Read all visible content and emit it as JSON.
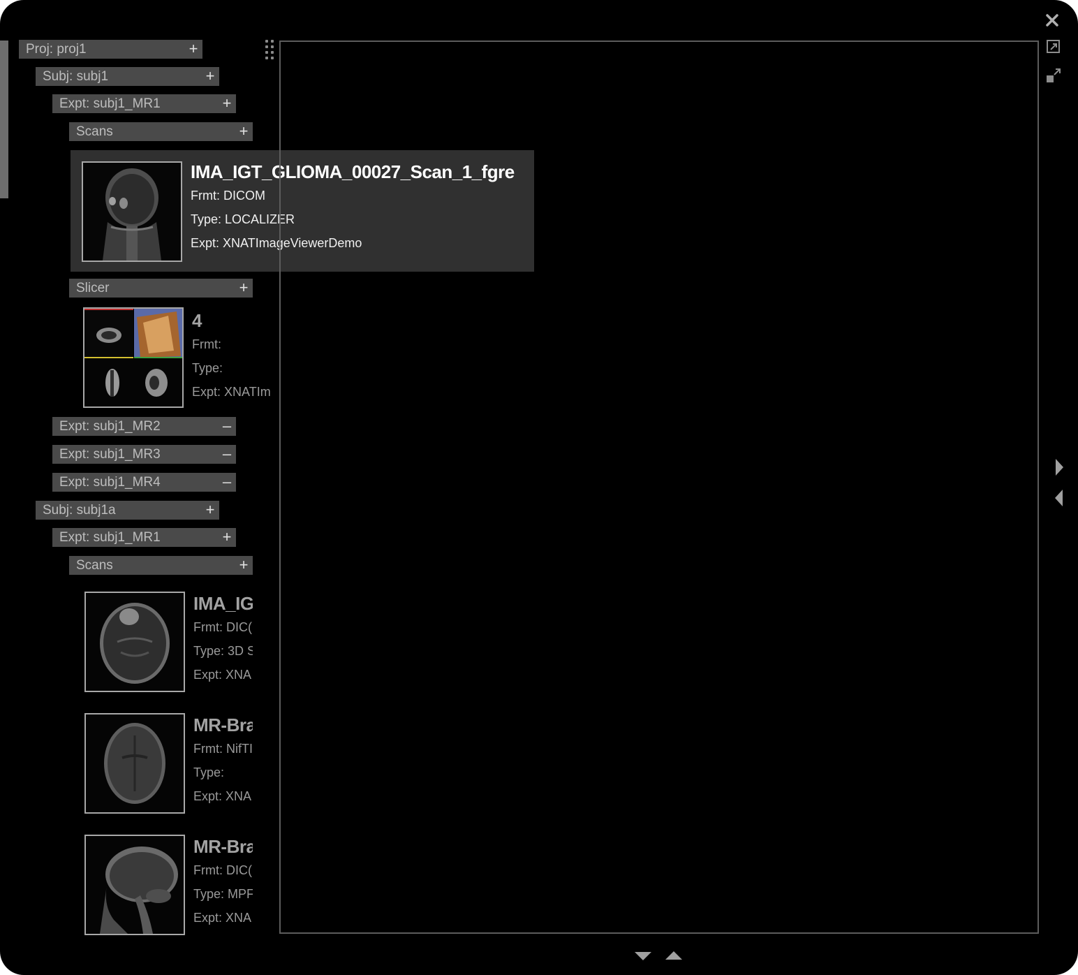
{
  "tree": {
    "project": {
      "label": "Proj: proj1",
      "toggle": "+"
    },
    "subject1": {
      "label": "Subj: subj1",
      "toggle": "+"
    },
    "expt_mr1": {
      "label": "Expt: subj1_MR1",
      "toggle": "+"
    },
    "scans1": {
      "label": "Scans",
      "toggle": "+"
    },
    "slicer": {
      "label": "Slicer",
      "toggle": "+"
    },
    "expt_mr2": {
      "label": "Expt: subj1_MR2",
      "toggle": "–"
    },
    "expt_mr3": {
      "label": "Expt: subj1_MR3",
      "toggle": "–"
    },
    "expt_mr4": {
      "label": "Expt: subj1_MR4",
      "toggle": "–"
    },
    "subject1a": {
      "label": "Subj: subj1a",
      "toggle": "+"
    },
    "expt_mr1b": {
      "label": "Expt: subj1_MR1",
      "toggle": "+"
    },
    "scans2": {
      "label": "Scans",
      "toggle": "+"
    }
  },
  "hover_card": {
    "title": "IMA_IGT_GLIOMA_00027_Scan_1_fgre",
    "format": "Frmt: DICOM",
    "type": "Type: LOCALIZER",
    "expt": "Expt: XNATImageViewerDemo"
  },
  "slicer_item": {
    "title": "4",
    "format": "Frmt:",
    "type": "Type:",
    "expt": "Expt: XNATIm"
  },
  "scan_items": [
    {
      "title": "IMA_IG",
      "format": "Frmt: DIC(",
      "type": "Type: 3D S",
      "expt": "Expt: XNA"
    },
    {
      "title": "MR-Bra",
      "format": "Frmt: NifTI",
      "type": "Type:",
      "expt": "Expt: XNA"
    },
    {
      "title": "MR-Bra",
      "format": "Frmt: DIC(",
      "type": "Type: MPF",
      "expt": "Expt: XNA"
    }
  ],
  "icons": {
    "close": "close-icon",
    "expand": "expand-icon",
    "collapse": "collapse-icon",
    "next": "arrow-right-icon",
    "prev": "arrow-left-icon",
    "down": "arrow-down-icon",
    "up": "arrow-up-icon",
    "drag": "drag-handle-icon"
  }
}
